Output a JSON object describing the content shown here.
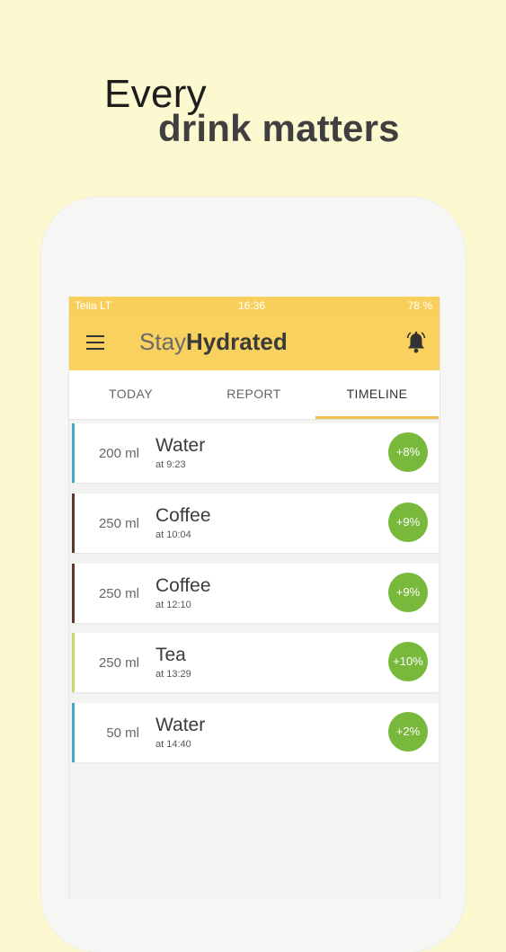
{
  "headline": {
    "line1": "Every",
    "line2": "drink matters"
  },
  "status_bar": {
    "carrier": "Telia LT",
    "time": "16:36",
    "battery": "78 %"
  },
  "app_bar": {
    "title_light": "Stay",
    "title_bold": "Hydrated",
    "menu_icon": "hamburger-menu-icon",
    "bell_icon": "bell-icon"
  },
  "tabs": [
    {
      "label": "TODAY",
      "active": false
    },
    {
      "label": "REPORT",
      "active": false
    },
    {
      "label": "TIMELINE",
      "active": true
    }
  ],
  "entries": [
    {
      "amount": "200 ml",
      "drink": "Water",
      "time": "at 9:23",
      "percent": "+8%",
      "color": "#49a7bd"
    },
    {
      "amount": "250 ml",
      "drink": "Coffee",
      "time": "at 10:04",
      "percent": "+9%",
      "color": "#5a3a2e"
    },
    {
      "amount": "250 ml",
      "drink": "Coffee",
      "time": "at 12:10",
      "percent": "+9%",
      "color": "#5a3a2e"
    },
    {
      "amount": "250 ml",
      "drink": "Tea",
      "time": "at 13:29",
      "percent": "+10%",
      "color": "#c7d86a"
    },
    {
      "amount": "50 ml",
      "drink": "Water",
      "time": "at 14:40",
      "percent": "+2%",
      "color": "#49a7bd"
    }
  ],
  "colors": {
    "background": "#fcf8cf",
    "app_bar": "#f9d15e",
    "badge": "#78b93c",
    "tab_indicator": "#f2c153"
  }
}
